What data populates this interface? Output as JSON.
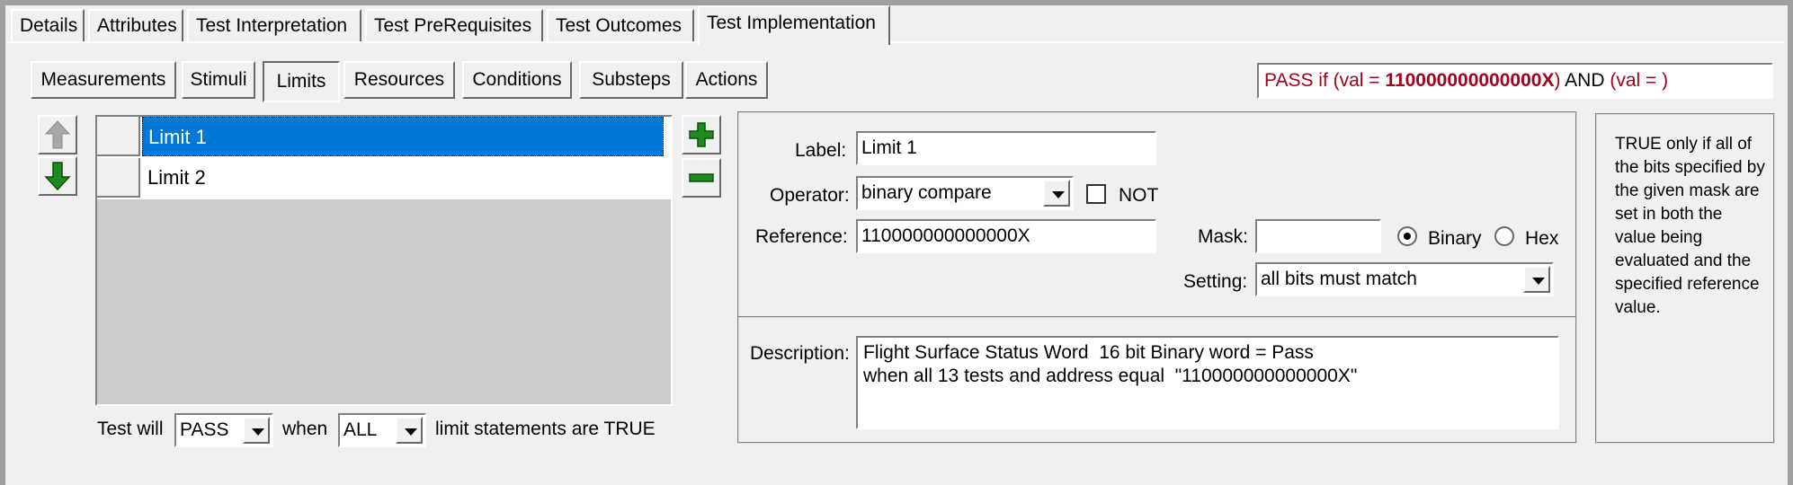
{
  "tabs": [
    {
      "label": "Details"
    },
    {
      "label": "Attributes"
    },
    {
      "label": "Test Interpretation"
    },
    {
      "label": "Test PreRequisites"
    },
    {
      "label": "Test Outcomes"
    },
    {
      "label": "Test Implementation",
      "active": true
    }
  ],
  "subtabs": [
    {
      "label": "Measurements"
    },
    {
      "label": "Stimuli"
    },
    {
      "label": "Limits",
      "active": true
    },
    {
      "label": "Resources"
    },
    {
      "label": "Conditions"
    },
    {
      "label": "Substeps"
    },
    {
      "label": "Actions"
    }
  ],
  "formula": {
    "prefix": "PASS if (val = ",
    "value": "110000000000000X",
    "suffix": ")",
    "and": " AND ",
    "second": "(val = )"
  },
  "limits": [
    {
      "label": "Limit 1",
      "selected": true
    },
    {
      "label": "Limit 2",
      "selected": false
    }
  ],
  "pass_rule": {
    "prefix": "Test will",
    "result": "PASS",
    "when": "when",
    "quantifier": "ALL",
    "suffix": "limit statements are TRUE"
  },
  "detail": {
    "label_caption": "Label:",
    "label_value": "Limit 1",
    "operator_caption": "Operator:",
    "operator_value": "binary compare",
    "not_label": "NOT",
    "not_checked": false,
    "reference_caption": "Reference:",
    "reference_value": "110000000000000X",
    "mask_caption": "Mask:",
    "mask_value": "",
    "radix_binary": "Binary",
    "radix_hex": "Hex",
    "radix_selected": "Binary",
    "setting_caption": "Setting:",
    "setting_value": "all bits must match",
    "description_caption": "Description:",
    "description_value": "Flight Surface Status Word  16 bit Binary word = Pass\nwhen all 13 tests and address equal  \"110000000000000X\""
  },
  "help_text": "TRUE only if all of the bits specified by the given mask are set in both the value being evaluated and the specified reference value.",
  "colors": {
    "window_bg": "#f0f0f0",
    "selection": "#0078d7",
    "formula_red": "#a3001c",
    "plus_green": "#1f8a1f",
    "arrow_green": "#1f8a1f",
    "list_bg": "#cbcbcb"
  },
  "icons": {
    "move_up": "arrow-up-icon",
    "move_down": "arrow-down-icon",
    "add": "plus-icon",
    "remove": "minus-icon"
  }
}
